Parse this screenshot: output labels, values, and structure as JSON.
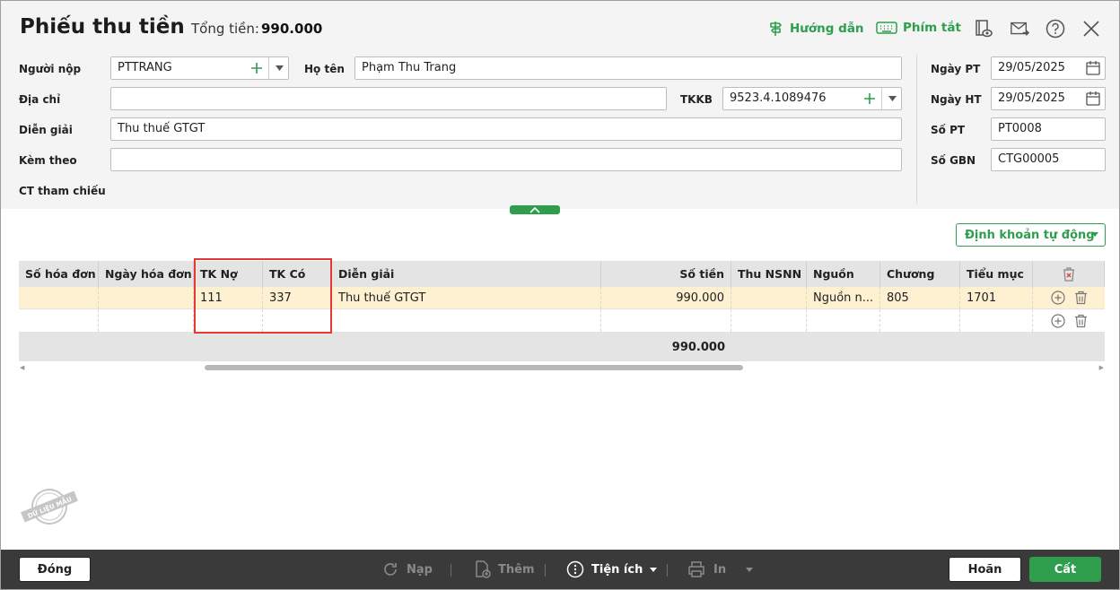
{
  "header": {
    "title": "Phiếu thu tiền",
    "total_label": "Tổng tiền:",
    "total_value": "990.000",
    "guide_label": "Hướng dẫn",
    "shortcut_label": "Phím tắt"
  },
  "form": {
    "payer_label": "Người nộp",
    "payer_value": "PTTRANG",
    "name_label": "Họ tên",
    "name_value": "Phạm Thu Trang",
    "address_label": "Địa chỉ",
    "address_value": "",
    "tkkb_label": "TKKB",
    "tkkb_value": "9523.4.1089476",
    "desc_label": "Diễn giải",
    "desc_value": "Thu thuế GTGT",
    "attach_label": "Kèm theo",
    "attach_value": "",
    "ref_label": "CT tham chiếu",
    "date_pt_label": "Ngày PT",
    "date_pt_value": "29/05/2025",
    "date_ht_label": "Ngày HT",
    "date_ht_value": "29/05/2025",
    "so_pt_label": "Số PT",
    "so_pt_value": "PT0008",
    "so_gbn_label": "Số GBN",
    "so_gbn_value": "CTG00005"
  },
  "auto_account_label": "Định khoản tự động",
  "table": {
    "headers": [
      "Số hóa đơn",
      "Ngày hóa đơn",
      "TK Nợ",
      "TK Có",
      "Diễn giải",
      "Số tiền",
      "Thu NSNN",
      "Nguồn",
      "Chương",
      "Tiểu mục"
    ],
    "rows": [
      [
        "",
        "",
        "111",
        "337",
        "Thu thuế GTGT",
        "990.000",
        "",
        "Nguồn n...",
        "805",
        "1701"
      ],
      [
        "",
        "",
        "",
        "",
        "",
        "",
        "",
        "",
        "",
        ""
      ]
    ],
    "total": "990.000"
  },
  "watermark_text": "DỮ LIỆU MẪU",
  "footer": {
    "close_label": "Đóng",
    "reload_label": "Nạp",
    "add_label": "Thêm",
    "utility_label": "Tiện ích",
    "print_label": "In",
    "cancel_label": "Hoãn",
    "save_label": "Cất"
  },
  "colors": {
    "accent": "#2e9e4d",
    "highlight": "#e53935",
    "selected_row": "#fdf1d1",
    "footer_bg": "#3a3a3a"
  }
}
